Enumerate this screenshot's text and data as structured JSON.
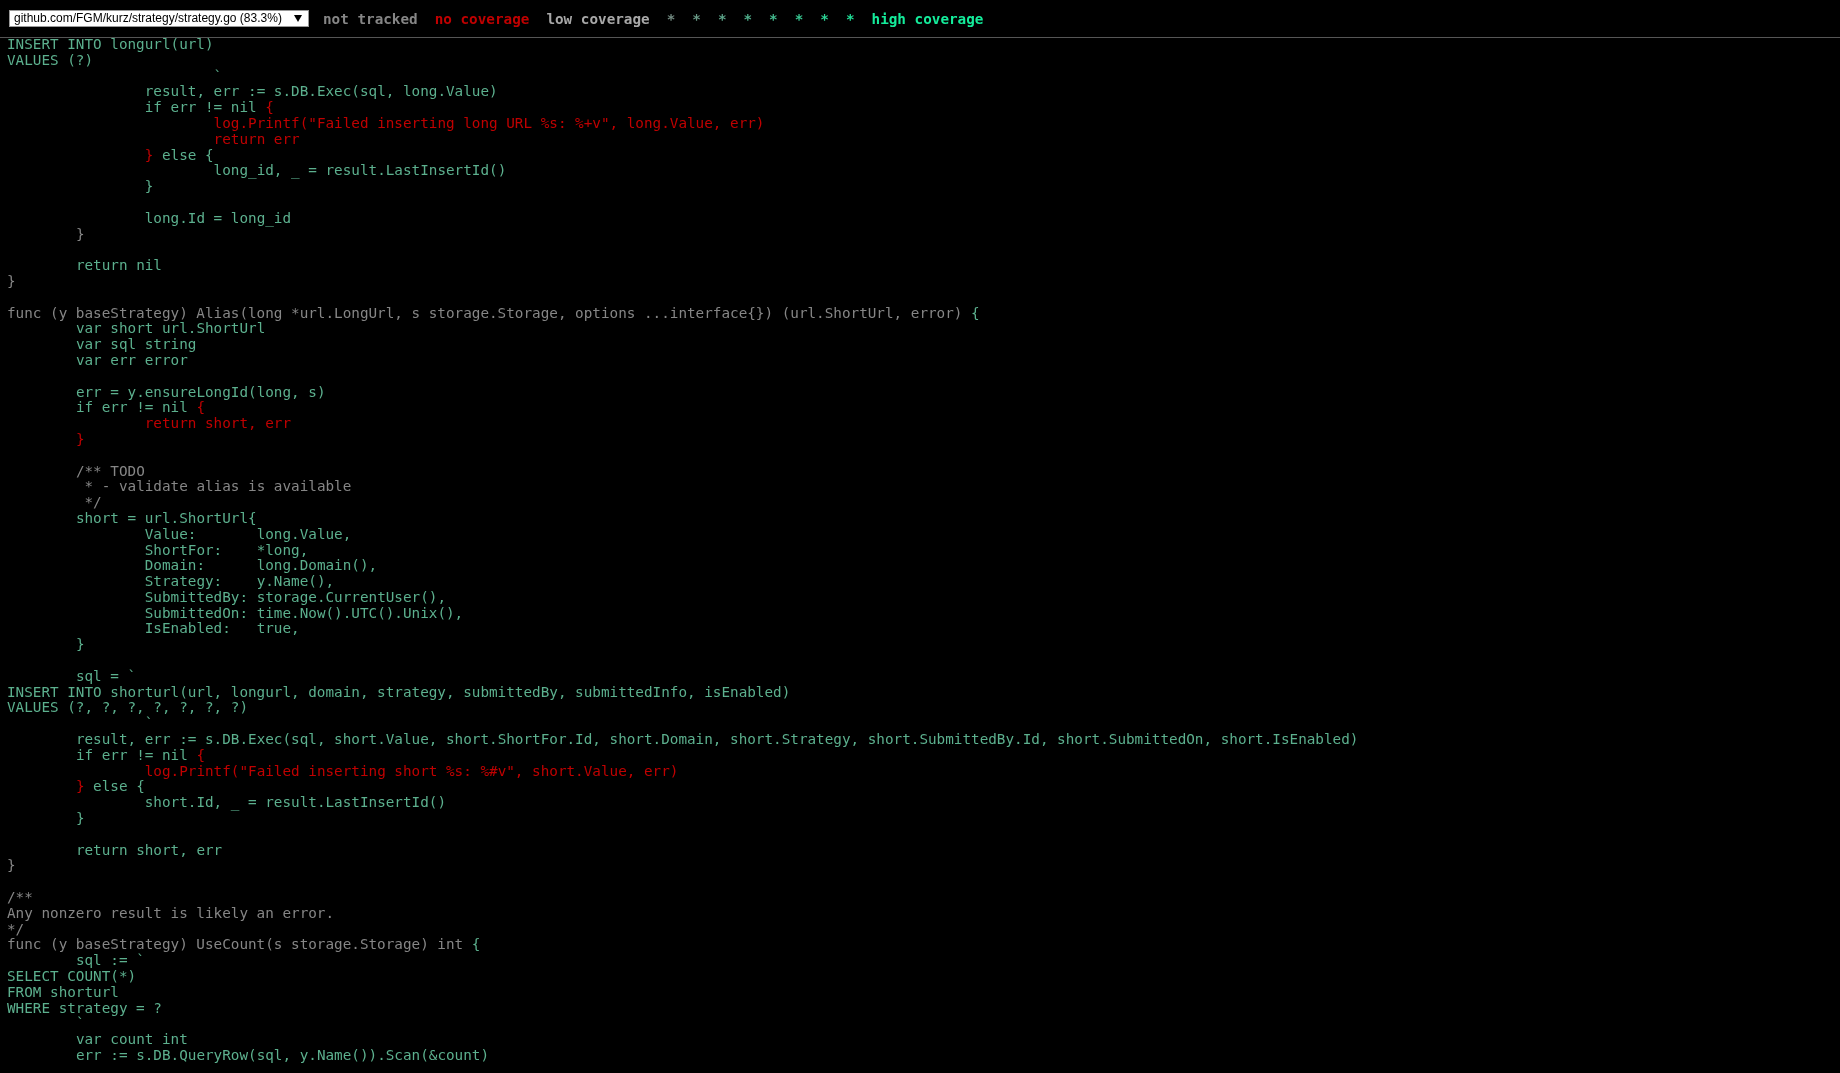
{
  "file_select": {
    "value": "github.com/FGM/kurz/strategy/strategy.go (83.3%)"
  },
  "legend": [
    {
      "text": "not tracked",
      "color": "#868686"
    },
    {
      "text": "no coverage",
      "color": "#c00000"
    },
    {
      "text": "low coverage",
      "color": "#a8a8a8"
    },
    {
      "text": "*",
      "color": "#748c83"
    },
    {
      "text": "*",
      "color": "#689886"
    },
    {
      "text": "*",
      "color": "#5ca489"
    },
    {
      "text": "*",
      "color": "#50b08c"
    },
    {
      "text": "*",
      "color": "#44bc8f"
    },
    {
      "text": "*",
      "color": "#38c892"
    },
    {
      "text": "*",
      "color": "#2cd495"
    },
    {
      "text": "*",
      "color": "#20e098"
    },
    {
      "text": "high coverage",
      "color": "#14ec9b"
    }
  ],
  "code_lines": [
    {
      "kind": "code",
      "segments": [
        {
          "kind": "covered",
          "text": "INSERT INTO longurl(url)"
        }
      ]
    },
    {
      "kind": "code",
      "segments": [
        {
          "kind": "covered",
          "text": "VALUES (?)"
        }
      ]
    },
    {
      "kind": "code",
      "segments": [
        {
          "kind": "covered",
          "text": "\t\t\t`"
        }
      ]
    },
    {
      "kind": "code",
      "segments": [
        {
          "kind": "covered",
          "text": "\t\tresult, err := s.DB.Exec(sql, long.Value)"
        }
      ]
    },
    {
      "kind": "code",
      "segments": [
        {
          "kind": "covered",
          "text": "\t\tif err != nil "
        },
        {
          "kind": "uncovered",
          "text": "{"
        }
      ]
    },
    {
      "kind": "code",
      "segments": [
        {
          "kind": "uncovered",
          "text": "\t\t\tlog.Printf(\"Failed inserting long URL %s: %+v\", long.Value, err)"
        }
      ]
    },
    {
      "kind": "code",
      "segments": [
        {
          "kind": "uncovered",
          "text": "\t\t\treturn err"
        }
      ]
    },
    {
      "kind": "code",
      "segments": [
        {
          "kind": "uncovered",
          "text": "\t\t}"
        },
        {
          "kind": "covered",
          "text": " else {"
        }
      ]
    },
    {
      "kind": "code",
      "segments": [
        {
          "kind": "covered",
          "text": "\t\t\tlong_id, _ = result.LastInsertId()"
        }
      ]
    },
    {
      "kind": "code",
      "segments": [
        {
          "kind": "covered",
          "text": "\t\t}"
        }
      ]
    },
    {
      "kind": "blank"
    },
    {
      "kind": "code",
      "segments": [
        {
          "kind": "covered",
          "text": "\t\tlong.Id = long_id"
        }
      ]
    },
    {
      "kind": "code",
      "segments": [
        {
          "kind": "untracked",
          "text": "\t}"
        }
      ]
    },
    {
      "kind": "blank"
    },
    {
      "kind": "code",
      "segments": [
        {
          "kind": "covered",
          "text": "\treturn nil"
        }
      ]
    },
    {
      "kind": "code",
      "segments": [
        {
          "kind": "untracked",
          "text": "}"
        }
      ]
    },
    {
      "kind": "blank"
    },
    {
      "kind": "code",
      "segments": [
        {
          "kind": "untracked",
          "text": "func (y baseStrategy) Alias(long *url.LongUrl, s storage.Storage, options ...interface{}) (url.ShortUrl, error) "
        },
        {
          "kind": "covered",
          "text": "{"
        }
      ]
    },
    {
      "kind": "code",
      "segments": [
        {
          "kind": "covered",
          "text": "\tvar short url.ShortUrl"
        }
      ]
    },
    {
      "kind": "code",
      "segments": [
        {
          "kind": "covered",
          "text": "\tvar sql string"
        }
      ]
    },
    {
      "kind": "code",
      "segments": [
        {
          "kind": "covered",
          "text": "\tvar err error"
        }
      ]
    },
    {
      "kind": "blank"
    },
    {
      "kind": "code",
      "segments": [
        {
          "kind": "covered",
          "text": "\terr = y.ensureLongId(long, s)"
        }
      ]
    },
    {
      "kind": "code",
      "segments": [
        {
          "kind": "covered",
          "text": "\tif err != nil "
        },
        {
          "kind": "uncovered",
          "text": "{"
        }
      ]
    },
    {
      "kind": "code",
      "segments": [
        {
          "kind": "uncovered",
          "text": "\t\treturn short, err"
        }
      ]
    },
    {
      "kind": "code",
      "segments": [
        {
          "kind": "uncovered",
          "text": "\t}"
        }
      ]
    },
    {
      "kind": "blank"
    },
    {
      "kind": "code",
      "segments": [
        {
          "kind": "untracked",
          "text": "\t/** TODO"
        }
      ]
    },
    {
      "kind": "code",
      "segments": [
        {
          "kind": "untracked",
          "text": "\t * - validate alias is available"
        }
      ]
    },
    {
      "kind": "code",
      "segments": [
        {
          "kind": "untracked",
          "text": "\t */"
        }
      ]
    },
    {
      "kind": "code",
      "segments": [
        {
          "kind": "covered",
          "text": "\tshort = url.ShortUrl{"
        }
      ]
    },
    {
      "kind": "code",
      "segments": [
        {
          "kind": "covered",
          "text": "\t\tValue:       long.Value,"
        }
      ]
    },
    {
      "kind": "code",
      "segments": [
        {
          "kind": "covered",
          "text": "\t\tShortFor:    *long,"
        }
      ]
    },
    {
      "kind": "code",
      "segments": [
        {
          "kind": "covered",
          "text": "\t\tDomain:      long.Domain(),"
        }
      ]
    },
    {
      "kind": "code",
      "segments": [
        {
          "kind": "covered",
          "text": "\t\tStrategy:    y.Name(),"
        }
      ]
    },
    {
      "kind": "code",
      "segments": [
        {
          "kind": "covered",
          "text": "\t\tSubmittedBy: storage.CurrentUser(),"
        }
      ]
    },
    {
      "kind": "code",
      "segments": [
        {
          "kind": "covered",
          "text": "\t\tSubmittedOn: time.Now().UTC().Unix(),"
        }
      ]
    },
    {
      "kind": "code",
      "segments": [
        {
          "kind": "covered",
          "text": "\t\tIsEnabled:   true,"
        }
      ]
    },
    {
      "kind": "code",
      "segments": [
        {
          "kind": "covered",
          "text": "\t}"
        }
      ]
    },
    {
      "kind": "blank"
    },
    {
      "kind": "code",
      "segments": [
        {
          "kind": "covered",
          "text": "\tsql = `"
        }
      ]
    },
    {
      "kind": "code",
      "segments": [
        {
          "kind": "covered",
          "text": "INSERT INTO shorturl(url, longurl, domain, strategy, submittedBy, submittedInfo, isEnabled)"
        }
      ]
    },
    {
      "kind": "code",
      "segments": [
        {
          "kind": "covered",
          "text": "VALUES (?, ?, ?, ?, ?, ?, ?)"
        }
      ]
    },
    {
      "kind": "code",
      "segments": [
        {
          "kind": "covered",
          "text": "\t\t`"
        }
      ]
    },
    {
      "kind": "code",
      "segments": [
        {
          "kind": "covered",
          "text": "\tresult, err := s.DB.Exec(sql, short.Value, short.ShortFor.Id, short.Domain, short.Strategy, short.SubmittedBy.Id, short.SubmittedOn, short.IsEnabled)"
        }
      ]
    },
    {
      "kind": "code",
      "segments": [
        {
          "kind": "covered",
          "text": "\tif err != nil "
        },
        {
          "kind": "uncovered",
          "text": "{"
        }
      ]
    },
    {
      "kind": "code",
      "segments": [
        {
          "kind": "uncovered",
          "text": "\t\tlog.Printf(\"Failed inserting short %s: %#v\", short.Value, err)"
        }
      ]
    },
    {
      "kind": "code",
      "segments": [
        {
          "kind": "uncovered",
          "text": "\t}"
        },
        {
          "kind": "covered",
          "text": " else {"
        }
      ]
    },
    {
      "kind": "code",
      "segments": [
        {
          "kind": "covered",
          "text": "\t\tshort.Id, _ = result.LastInsertId()"
        }
      ]
    },
    {
      "kind": "code",
      "segments": [
        {
          "kind": "covered",
          "text": "\t}"
        }
      ]
    },
    {
      "kind": "blank"
    },
    {
      "kind": "code",
      "segments": [
        {
          "kind": "covered",
          "text": "\treturn short, err"
        }
      ]
    },
    {
      "kind": "code",
      "segments": [
        {
          "kind": "untracked",
          "text": "}"
        }
      ]
    },
    {
      "kind": "blank"
    },
    {
      "kind": "code",
      "segments": [
        {
          "kind": "untracked",
          "text": "/**"
        }
      ]
    },
    {
      "kind": "code",
      "segments": [
        {
          "kind": "untracked",
          "text": "Any nonzero result is likely an error."
        }
      ]
    },
    {
      "kind": "code",
      "segments": [
        {
          "kind": "untracked",
          "text": "*/"
        }
      ]
    },
    {
      "kind": "code",
      "segments": [
        {
          "kind": "untracked",
          "text": "func (y baseStrategy) UseCount(s storage.Storage) int "
        },
        {
          "kind": "covered",
          "text": "{"
        }
      ]
    },
    {
      "kind": "code",
      "segments": [
        {
          "kind": "covered",
          "text": "\tsql := `"
        }
      ]
    },
    {
      "kind": "code",
      "segments": [
        {
          "kind": "covered",
          "text": "SELECT COUNT(*)"
        }
      ]
    },
    {
      "kind": "code",
      "segments": [
        {
          "kind": "covered",
          "text": "FROM shorturl"
        }
      ]
    },
    {
      "kind": "code",
      "segments": [
        {
          "kind": "covered",
          "text": "WHERE strategy = ?"
        }
      ]
    },
    {
      "kind": "code",
      "segments": [
        {
          "kind": "covered",
          "text": "\t`"
        }
      ]
    },
    {
      "kind": "code",
      "segments": [
        {
          "kind": "covered",
          "text": "\tvar count int"
        }
      ]
    },
    {
      "kind": "code",
      "segments": [
        {
          "kind": "covered",
          "text": "\terr := s.DB.QueryRow(sql, y.Name()).Scan(&count)"
        }
      ]
    }
  ]
}
